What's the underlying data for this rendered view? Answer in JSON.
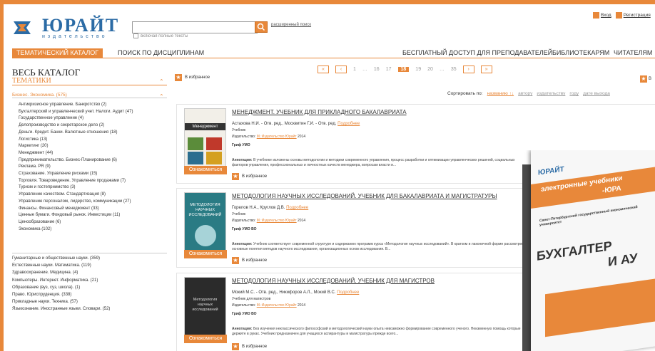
{
  "header": {
    "logo_name": "ЮРАЙТ",
    "logo_sub": "издательство",
    "search_placeholder": "",
    "advanced_search": "расширенный поиск",
    "fulltext_label": "включая полные тексты",
    "login": "Вход",
    "register": "Регистрация"
  },
  "nav": {
    "items": [
      "ТЕМАТИЧЕСКИЙ КАТАЛОГ",
      "ПОИСК ПО ДИСЦИПЛИНАМ",
      "БЕСПЛАТНЫЙ ДОСТУП ДЛЯ ПРЕПОДАВАТЕЛЕЙ",
      "БИБЛИОТЕКАРЯМ",
      "ЧИТАТЕЛЯМ"
    ]
  },
  "sidebar": {
    "title": "ВЕСЬ КАТАЛОГ",
    "subtitle": "ТЕМАТИКИ",
    "category": "Бизнес. Экономика. (575)",
    "subcats": [
      "Антикризисное управление. Банкротство (2)",
      "Бухгалтерский и управленческий учет. Налоги. Аудит (47)",
      "Государственное управление (4)",
      "Делопроизводство и секретарское дело (2)",
      "Деньги. Кредит. Банки. Валютные отношения (18)",
      "Логистика (13)",
      "Маркетинг (20)",
      "Менеджмент (44)",
      "Предпринимательство. Бизнес-Планирование (6)",
      "Реклама. PR (9)",
      "Страхование. Управление рисками (15)",
      "Торговля. Товароведение. Управление продажами (7)",
      "Туризм и гостеприимство (3)",
      "Управление качеством. Стандартизация (8)",
      "Управление персоналом, лидерство, коммуникации (27)",
      "Финансы. Финансовый менеджмент (33)",
      "Ценные бумаги. Фондовый рынок. Инвестиции (11)",
      "Ценообразование (6)",
      "Экономика (102)"
    ],
    "topcats": [
      "Гуманитарные и общественные науки. (359)",
      "Естественные науки. Математика. (119)",
      "Здравоохранение. Медицина. (4)",
      "Компьютеры. Интернет. Информатика. (21)",
      "Образование (вуз, суз, школа). (1)",
      "Право. Юриспруденция. (338)",
      "Прикладные науки. Техника. (57)",
      "Языкознание. Иностранные языки. Словари. (52)"
    ]
  },
  "main": {
    "fav_top": "В избранное",
    "extra_fav": "В",
    "pager": {
      "first": "«",
      "prev": "‹",
      "pages": [
        "1",
        "…",
        "16",
        "17",
        "18",
        "19",
        "20",
        "…",
        "35"
      ],
      "current": "18",
      "next": "›",
      "last": "»"
    },
    "sort": {
      "label": "Сортировать по:",
      "options": [
        "названию ↑↓",
        "автору",
        "издательству",
        "году",
        "дате выхода"
      ]
    },
    "read_button": "Ознакомиться",
    "fav_label": "В избранное",
    "books": [
      {
        "title": "МЕНЕДЖМЕНТ. Учебник для прикладного бакалавриата",
        "authors": "Астахова Н.И. - Отв. ред., Москвитин Г.И. - Отв. ред.",
        "more": "Подробнее",
        "type": "Учебник",
        "publisher_label": "Издательство:",
        "publisher": "М.:Издательство Юрайт",
        "year": "2014",
        "grif": "Гриф УМО",
        "anno_label": "Аннотация:",
        "annotation": "В учебнике изложены основы методологии и методики современного управления, процесс разработки и оптимизации управленческих решений, социальных факторов управления, профессиональных и личностных качеств менеджера, вопросам власти и...",
        "cover_title": "Менеджмент"
      },
      {
        "title": "МЕТОДОЛОГИЯ НАУЧНЫХ ИССЛЕДОВАНИЙ. Учебник для бакалавриата и магистратуры",
        "authors": "Горелов Н.А., Круглов Д.В.",
        "more": "Подробнее",
        "type": "Учебник",
        "publisher_label": "Издательство:",
        "publisher": "М.:Издательство Юрайт",
        "year": "2014",
        "grif": "Гриф УМО ВО",
        "anno_label": "Аннотация:",
        "annotation": "Учебник соответствует современной структуре и содержанию программ курса «Методология научных исследований». В кратком и лаконичной форме рассмотрены основные понятия методов научного исследования, организационных основ исследования. В...",
        "cover_title": "МЕТОДОЛОГИЯ НАУЧНЫХ ИССЛЕДОВАНИЙ"
      },
      {
        "title": "МЕТОДОЛОГИЯ НАУЧНЫХ ИССЛЕДОВАНИЙ. Учебник для магистров",
        "authors": "Мокий М.С. - Отв. ред., Никифоров А.Л., Мокий В.С.",
        "more": "Подробнее",
        "type": "Учебник для магистров",
        "publisher_label": "Издательство:",
        "publisher": "М.:Издательство Юрайт",
        "year": "2014",
        "grif": "Гриф УМО ВО",
        "anno_label": "Аннотация:",
        "annotation": "Без изучения неклассического философский и методологический науки опыта невозможно формирование современного ученого. Неизменную помощь которые держите в руках. Учебник предназначен для учащихся аспирантуры и магистратуры прежде всего...",
        "cover_title": "Методология научных исследований"
      }
    ]
  },
  "overlay_book": {
    "publisher": "ЮРАЙТ",
    "series": "электронные учебники",
    "series2": "-ЮРА",
    "university": "Санкт-Петербургский государственный экономический университет",
    "title": "БУХГАЛТЕР",
    "title2": "И АУ"
  },
  "colors": {
    "accent": "#e8883a",
    "brand": "#2b6ba5"
  }
}
